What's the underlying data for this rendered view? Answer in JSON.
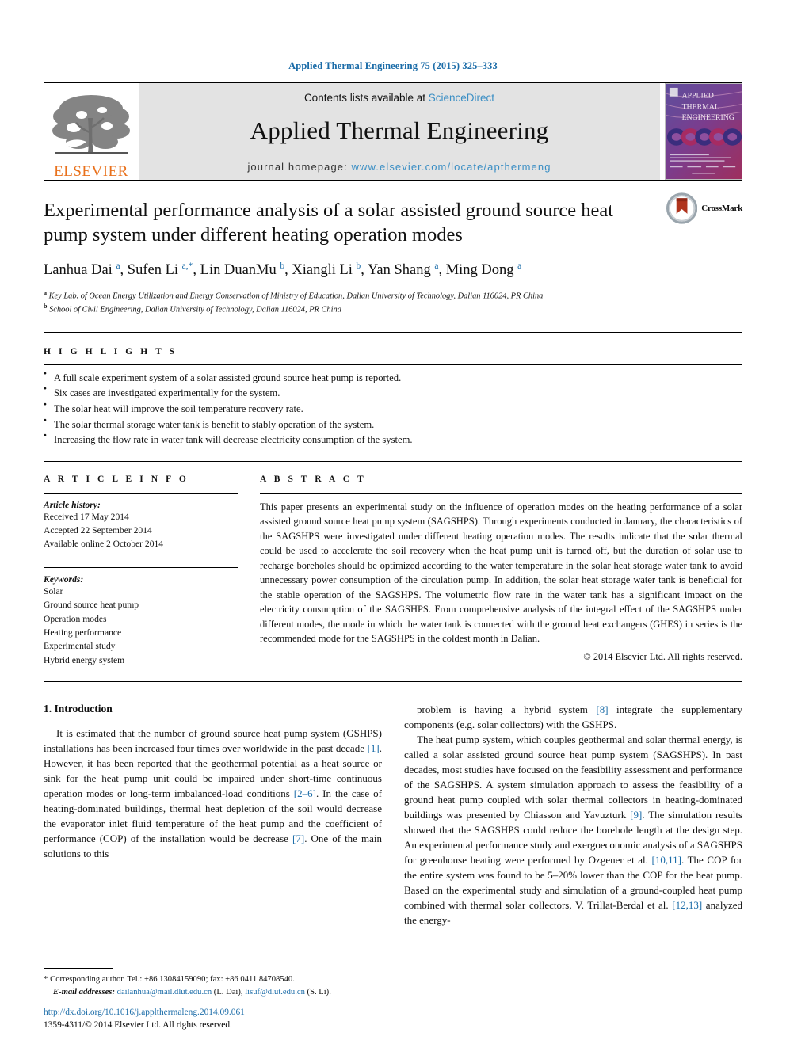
{
  "running_head": "Applied Thermal Engineering 75 (2015) 325–333",
  "masthead": {
    "contents_prefix": "Contents lists available at ",
    "sciencedirect": "ScienceDirect",
    "journal_title": "Applied Thermal Engineering",
    "homepage_prefix": "journal homepage: ",
    "homepage_url": "www.elsevier.com/locate/apthermeng",
    "publisher": "ELSEVIER",
    "cover_lines": [
      "APPLIED",
      "THERMAL",
      "ENGINEERING"
    ]
  },
  "article": {
    "title": "Experimental performance analysis of a solar assisted ground source heat pump system under different heating operation modes",
    "crossmark_label": "CrossMark",
    "authors_html": "Lanhua Dai <sup>a</sup>, Sufen Li <sup>a,*</sup>, Lin DuanMu <sup>b</sup>, Xiangli Li <sup>b</sup>, Yan Shang <sup>a</sup>, Ming Dong <sup>a</sup>",
    "affiliations": [
      {
        "marker": "a",
        "text": "Key Lab. of Ocean Energy Utilization and Energy Conservation of Ministry of Education, Dalian University of Technology, Dalian 116024, PR China"
      },
      {
        "marker": "b",
        "text": "School of Civil Engineering, Dalian University of Technology, Dalian 116024, PR China"
      }
    ]
  },
  "highlights": {
    "label": "H I G H L I G H T S",
    "items": [
      "A full scale experiment system of a solar assisted ground source heat pump is reported.",
      "Six cases are investigated experimentally for the system.",
      "The solar heat will improve the soil temperature recovery rate.",
      "The solar thermal storage water tank is benefit to stably operation of the system.",
      "Increasing the flow rate in water tank will decrease electricity consumption of the system."
    ]
  },
  "article_info": {
    "label": "A R T I C L E   I N F O",
    "history_label": "Article history:",
    "history": [
      "Received 17 May 2014",
      "Accepted 22 September 2014",
      "Available online 2 October 2014"
    ],
    "keywords_label": "Keywords:",
    "keywords": [
      "Solar",
      "Ground source heat pump",
      "Operation modes",
      "Heating performance",
      "Experimental study",
      "Hybrid energy system"
    ]
  },
  "abstract": {
    "label": "A B S T R A C T",
    "text": "This paper presents an experimental study on the influence of operation modes on the heating performance of a solar assisted ground source heat pump system (SAGSHPS). Through experiments conducted in January, the characteristics of the SAGSHPS were investigated under different heating operation modes. The results indicate that the solar thermal could be used to accelerate the soil recovery when the heat pump unit is turned off, but the duration of solar use to recharge boreholes should be optimized according to the water temperature in the solar heat storage water tank to avoid unnecessary power consumption of the circulation pump. In addition, the solar heat storage water tank is beneficial for the stable operation of the SAGSHPS. The volumetric flow rate in the water tank has a significant impact on the electricity consumption of the SAGSHPS. From comprehensive analysis of the integral effect of the SAGSHPS under different modes, the mode in which the water tank is connected with the ground heat exchangers (GHES) in series is the recommended mode for the SAGSHPS in the coldest month in Dalian.",
    "copyright": "© 2014 Elsevier Ltd. All rights reserved."
  },
  "body": {
    "section_number_title": "1.  Introduction",
    "left_paragraph_1_a": "It is estimated that the number of ground source heat pump system (GSHPS) installations has been increased four times over worldwide in the past decade ",
    "ref1": "[1]",
    "left_paragraph_1_b": ". However, it has been reported that the geothermal potential as a heat source or sink for the heat pump unit could be impaired under short-time continuous operation modes or long-term imbalanced-load conditions ",
    "ref2_6": "[2–6]",
    "left_paragraph_1_c": ". In the case of heating-dominated buildings, thermal heat depletion of the soil would decrease the evaporator inlet fluid temperature of the heat pump and the coefficient of performance (COP) of the installation would be decrease ",
    "ref7": "[7]",
    "left_paragraph_1_d": ". One of the main solutions to this",
    "right_paragraph_1_a": "problem is having a hybrid system ",
    "ref8": "[8]",
    "right_paragraph_1_b": " integrate the supplementary components (e.g. solar collectors) with the GSHPS.",
    "right_paragraph_2_a": "The heat pump system, which couples geothermal and solar thermal energy, is called a solar assisted ground source heat pump system (SAGSHPS). In past decades, most studies have focused on the feasibility assessment and performance of the SAGSHPS. A system simulation approach to assess the feasibility of a ground heat pump coupled with solar thermal collectors in heating-dominated buildings was presented by Chiasson and Yavuzturk ",
    "ref9": "[9]",
    "right_paragraph_2_b": ". The simulation results showed that the SAGSHPS could reduce the borehole length at the design step. An experimental performance study and exergoeconomic analysis of a SAGSHPS for greenhouse heating were performed by Ozgener et al. ",
    "ref10_11": "[10,11]",
    "right_paragraph_2_c": ". The COP for the entire system was found to be 5–20% lower than the COP for the heat pump. Based on the experimental study and simulation of a ground-coupled heat pump combined with thermal solar collectors, V. Trillat-Berdal et al. ",
    "ref12_13": "[12,13]",
    "right_paragraph_2_d": " analyzed the energy-"
  },
  "footnote": {
    "star": "*",
    "corresponding": " Corresponding author. Tel.: +86 13084159090; fax: +86 0411 84708540.",
    "email_label": "E-mail addresses:",
    "email1": "dailanhua@mail.dlut.edu.cn",
    "email1_owner": " (L. Dai), ",
    "email2": "lisuf@dlut.edu.cn",
    "email2_owner": " (S. Li)."
  },
  "page_footer": {
    "doi": "http://dx.doi.org/10.1016/j.applthermaleng.2014.09.061",
    "issn_line": "1359-4311/© 2014 Elsevier Ltd. All rights reserved."
  },
  "colors": {
    "link_blue": "#1b6ca8",
    "sciencedirect_blue": "#3a8ec4",
    "elsevier_orange": "#E9711C",
    "band_gray": "#e3e3e3"
  }
}
